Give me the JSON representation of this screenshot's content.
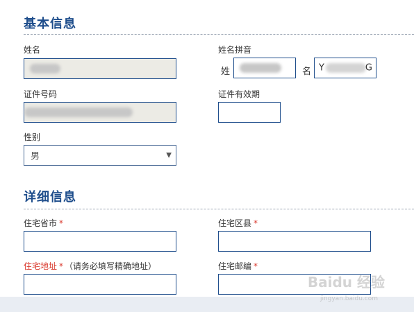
{
  "basic_info": {
    "title": "基本信息",
    "name_label": "姓名",
    "name_value": "",
    "pinyin_label": "姓名拼音",
    "surname_prefix": "姓",
    "given_prefix": "名",
    "given_value_start": "Y",
    "given_value_end": "G",
    "id_number_label": "证件号码",
    "id_validity_label": "证件有效期",
    "id_validity_value": "",
    "gender_label": "性别",
    "gender_value": "男"
  },
  "detail_info": {
    "title": "详细信息",
    "province_label": "住宅省市",
    "district_label": "住宅区县",
    "address_label": "住宅地址",
    "address_note": "（请务必填写精确地址）",
    "postcode_label": "住宅邮编",
    "required_mark": "*"
  },
  "watermark": {
    "text": "Baidu 经验",
    "sub": "jingyan.baidu.com"
  }
}
